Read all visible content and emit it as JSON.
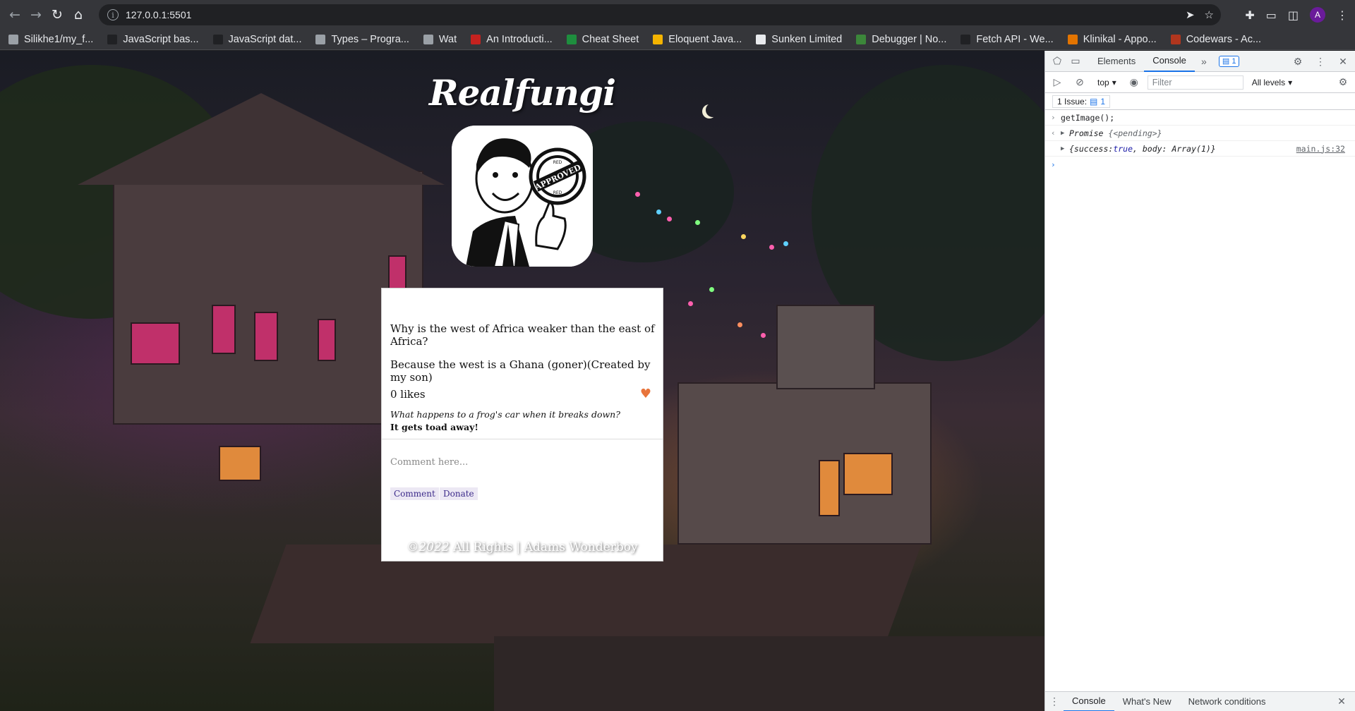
{
  "browser": {
    "url": "127.0.0.1:5501",
    "profile_initial": "A",
    "bookmarks": [
      {
        "label": "Silikhe1/my_f...",
        "icon": "github-icon",
        "color": "#9aa0a6"
      },
      {
        "label": "JavaScript bas...",
        "icon": "medium-icon",
        "color": "#202124"
      },
      {
        "label": "JavaScript dat...",
        "icon": "medium-icon",
        "color": "#202124"
      },
      {
        "label": "Types – Progra...",
        "icon": "braces-icon",
        "color": "#9aa0a6"
      },
      {
        "label": "Wat",
        "icon": "braces-icon",
        "color": "#9aa0a6"
      },
      {
        "label": "An Introducti...",
        "icon": "pdf-icon",
        "color": "#c5221f"
      },
      {
        "label": "Cheat Sheet",
        "icon": "leaf-icon",
        "color": "#1e8e3e"
      },
      {
        "label": "Eloquent Java...",
        "icon": "js-icon",
        "color": "#f4b400"
      },
      {
        "label": "Sunken Limited",
        "icon": "globe-icon",
        "color": "#e8eaed"
      },
      {
        "label": "Debugger | No...",
        "icon": "node-icon",
        "color": "#3c873a"
      },
      {
        "label": "Fetch API - We...",
        "icon": "mdn-icon",
        "color": "#202124"
      },
      {
        "label": "Klinikal - Appo...",
        "icon": "clinic-icon",
        "color": "#e37400"
      },
      {
        "label": "Codewars - Ac...",
        "icon": "codewars-icon",
        "color": "#b1361e"
      }
    ]
  },
  "page": {
    "title": "Realfungi",
    "logo": {
      "stamp_text": "APPROVED",
      "stamp_small_top": "RED",
      "stamp_small_bottom": "RED"
    },
    "joke": {
      "setup": "Why is the west of Africa weaker than the east of Africa?",
      "punchline": "Because the west is a Ghana (goner)(Created by my son)",
      "likes_text": "0 likes",
      "comment_question": "What happens to a frog's car when it breaks down?",
      "comment_answer": "It gets toad away!"
    },
    "comment_placeholder": "Comment here...",
    "comment_button": "Comment",
    "donate_button": "Donate",
    "footer_year": "©2022",
    "footer_text": " All Rights | Adams Wonderboy",
    "accent_heart_color": "#e8743b"
  },
  "devtools": {
    "tabs": [
      "Elements",
      "Console"
    ],
    "active_tab": "Console",
    "issues_badge": "1",
    "context_select": "top",
    "filter_placeholder": "Filter",
    "levels_select": "All levels",
    "issues_label": "1 Issue:",
    "issues_count": "1",
    "console": {
      "input_line": "getImage();",
      "promise_label": "Promise",
      "promise_state": "{<pending>}",
      "result_open": "{success: ",
      "result_success": "true",
      "result_body": ", body: Array(1)}",
      "result_source": "main.js:32"
    },
    "drawer_tabs": [
      "Console",
      "What's New",
      "Network conditions"
    ]
  }
}
